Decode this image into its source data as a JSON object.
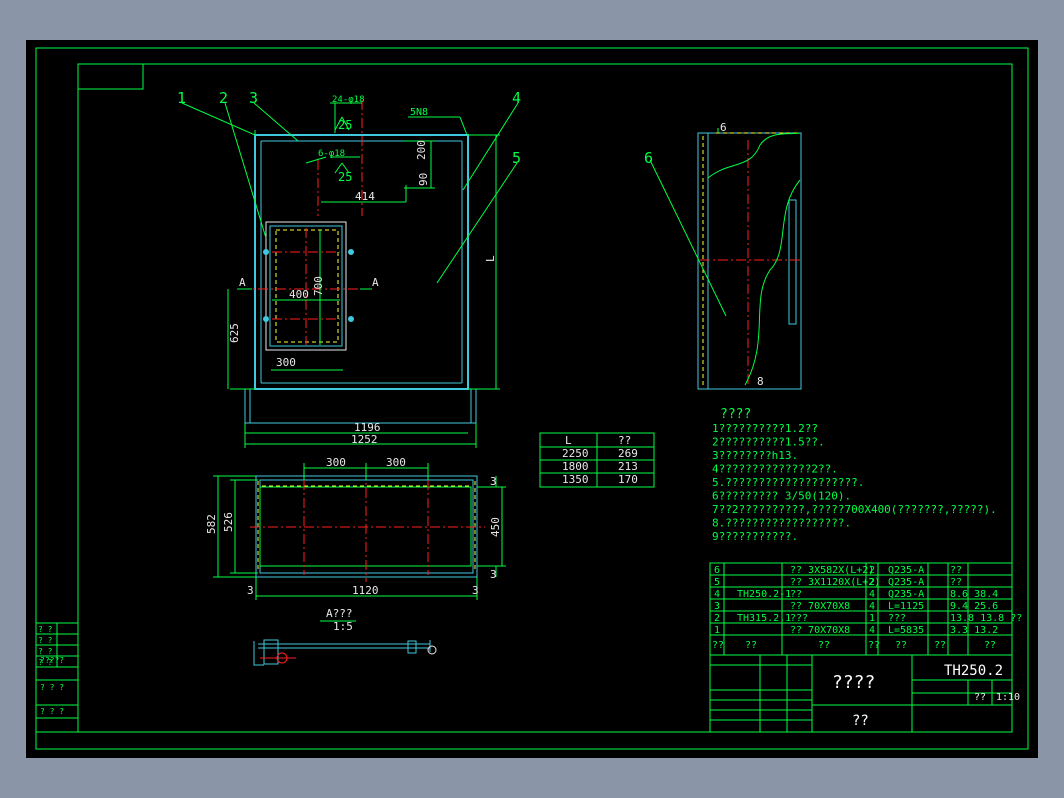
{
  "title_block": {
    "drawing_no": "TH250.2",
    "drawing_title": "????",
    "company": "??",
    "scale": "1:10",
    "unknown_a": "??"
  },
  "front_view": {
    "balloons": [
      "1",
      "2",
      "3",
      "4",
      "5"
    ],
    "weld_labels": [
      "24-φ18",
      "6-φ18",
      "5N8"
    ],
    "weld_values": [
      "25",
      "25"
    ],
    "dims": {
      "d200": "200",
      "d90": "90",
      "d414": "414",
      "d700": "700",
      "d400": "400",
      "d625": "625",
      "d300": "300",
      "d1196": "1196",
      "d1252": "1252",
      "L": "L",
      "secA": "A"
    }
  },
  "plan_view": {
    "dims": {
      "top1": "300",
      "top2": "300",
      "d582": "582",
      "d526": "526",
      "d450": "450",
      "d1120": "1120",
      "d3a": "3",
      "d3b": "3",
      "d3c": "3",
      "d3d": "3"
    }
  },
  "section_view": {
    "title": "A???",
    "scale": "1:5"
  },
  "side_view": {
    "balloon": "6",
    "dim_top": "6",
    "dim_bottom": "8"
  },
  "l_table": {
    "headers": [
      "L",
      "??"
    ],
    "rows": [
      [
        "2250",
        "269"
      ],
      [
        "1800",
        "213"
      ],
      [
        "1350",
        "170"
      ]
    ]
  },
  "notes": {
    "heading": "????",
    "lines": [
      "1??????????1.2??",
      "2??????????1.5??.",
      "3????????h13.",
      "4??????????????2??.",
      "5.????????????????????.",
      "6????????? 3/50(120).",
      "7??2??????????,?????700X400(???????,?????).",
      "8.??????????????????.",
      "9???????????."
    ]
  },
  "parts_list": {
    "rows": [
      {
        "no": "6",
        "code": "",
        "name": "?? 3X582X(L+2)",
        "qty": "2",
        "mat": "Q235-A",
        "note": "??"
      },
      {
        "no": "5",
        "code": "",
        "name": "?? 3X1120X(L+2)",
        "qty": "2",
        "mat": "Q235-A",
        "note": "??"
      },
      {
        "no": "4",
        "code": "TH250.2-1",
        "name": "??",
        "qty": "4",
        "mat": "Q235-A",
        "note": "8.6 38.4"
      },
      {
        "no": "3",
        "code": "",
        "name": "?? 70X70X8",
        "qty": "4",
        "mat": "L=1125",
        "note": "9.4 25.6"
      },
      {
        "no": "2",
        "code": "TH315.2.1",
        "name": "???",
        "qty": "1",
        "mat": "???",
        "note": "13.8 13.8 ??"
      },
      {
        "no": "1",
        "code": "",
        "name": "?? 70X70X8",
        "qty": "4",
        "mat": "L=5835",
        "note": "3.3 13.2"
      }
    ],
    "header": [
      "??",
      "??",
      "??",
      "??",
      "??",
      "??",
      "??"
    ]
  },
  "left_stamp": {
    "rows": [
      "? ?",
      "? ?",
      "? ?",
      "? ?",
      "?????",
      "? ? ?",
      "? ? ?"
    ]
  },
  "colors": {
    "green": "#00ff44",
    "cyan": "#3fc8e0",
    "red": "#ff2020",
    "yellow": "#ffff33",
    "white": "#e8e8e8"
  }
}
